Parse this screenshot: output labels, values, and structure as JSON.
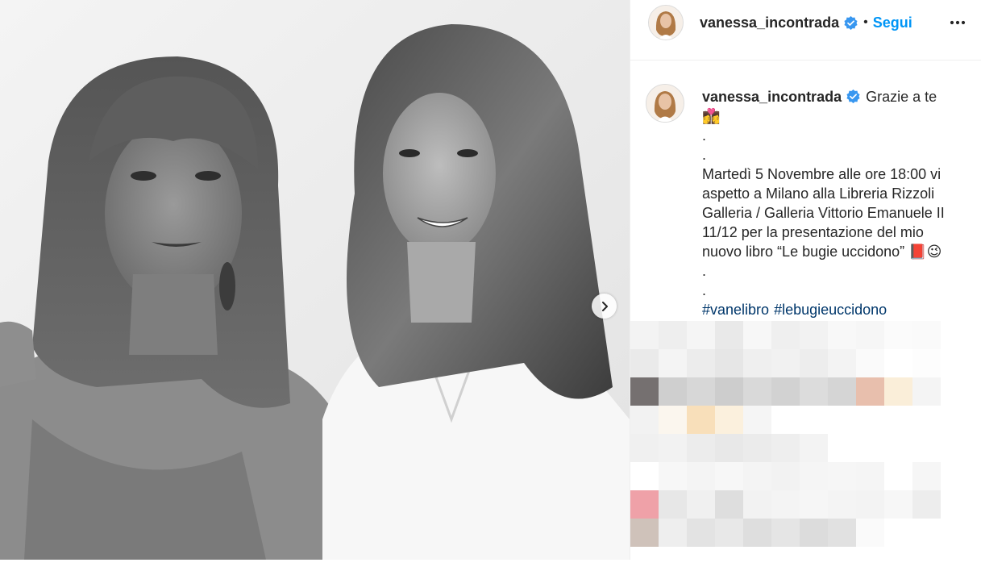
{
  "post": {
    "username": "vanessa_incontrada",
    "follow_label": "Segui",
    "separator": "•"
  },
  "caption": {
    "username": "vanessa_incontrada",
    "line1": "Grazie a te",
    "line2_emoji": "👩‍❤️‍💋‍👩",
    "dot1": ".",
    "dot2": ".",
    "body": [
      "Martedì 5 Novembre alle ore 18:00 vi",
      "aspetto a Milano alla Libreria Rizzoli",
      "Galleria / Galleria Vittorio Emanuele II",
      "11/12 per la presentazione del mio",
      "nuovo libro “Le bugie uccidono”"
    ],
    "body_end_emoji": "📕😉",
    "dot3": ".",
    "dot4": ".",
    "hashtags": [
      "#vanelibro",
      "#lebugieuccidono"
    ]
  },
  "icons": {
    "verified": "verified-badge-icon",
    "more": "more-options-icon",
    "next": "chevron-right-icon"
  },
  "colors": {
    "follow": "#0095f6",
    "verified": "#3897f0",
    "hashtag": "#00376b",
    "text": "#262626"
  }
}
